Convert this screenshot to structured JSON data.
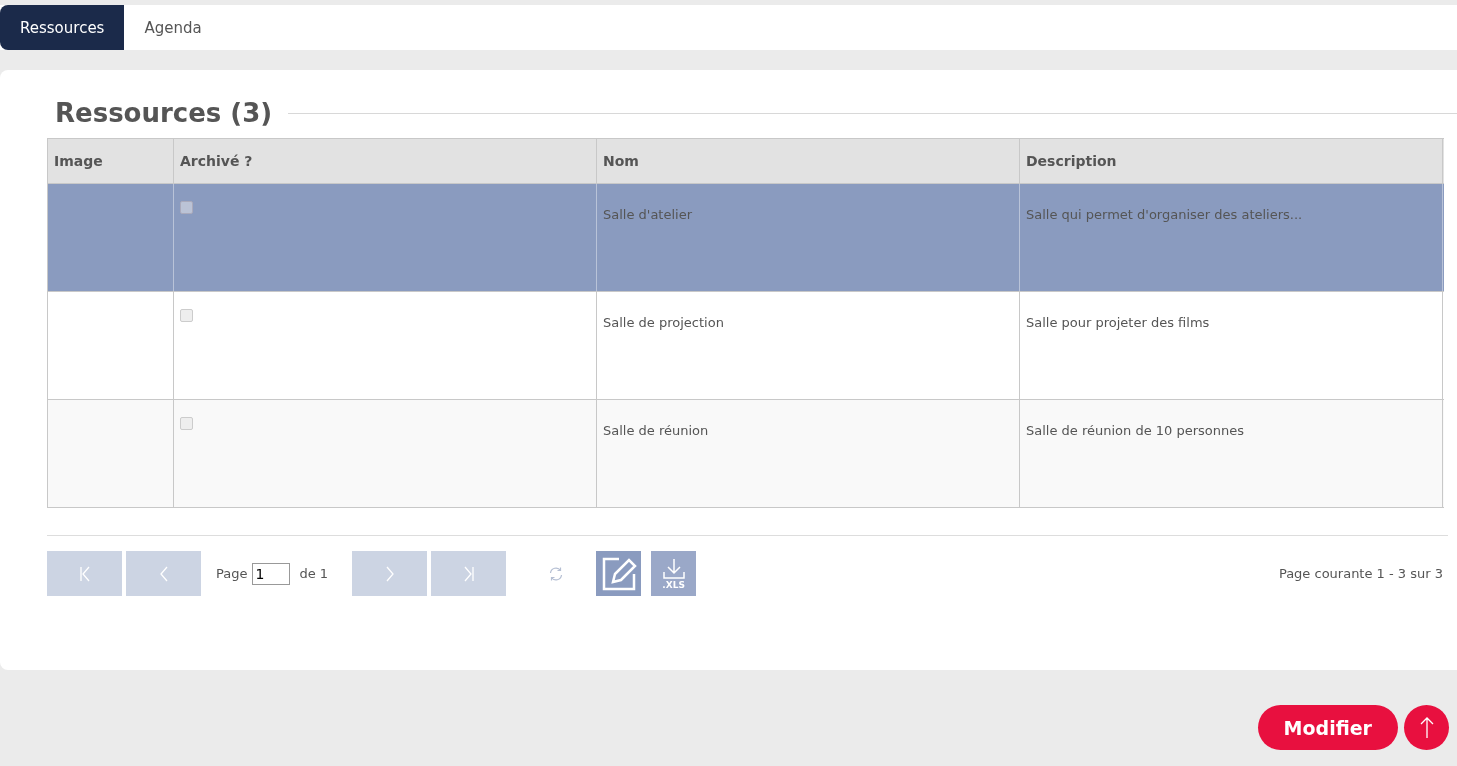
{
  "tabs": [
    {
      "label": "Ressources",
      "selected": true
    },
    {
      "label": "Agenda",
      "selected": false
    }
  ],
  "section": {
    "title": "Ressources (3)"
  },
  "table": {
    "columns": [
      "Image",
      "Archivé ?",
      "Nom",
      "Description"
    ],
    "rows": [
      {
        "selected": true,
        "archived": false,
        "name": "Salle d'atelier",
        "description": "Salle qui permet d'organiser des ateliers..."
      },
      {
        "selected": false,
        "archived": false,
        "name": "Salle de projection",
        "description": "Salle pour projeter des films"
      },
      {
        "selected": false,
        "archived": false,
        "name": "Salle de réunion",
        "description": "Salle de réunion de 10 personnes"
      }
    ]
  },
  "pager": {
    "nav": [
      {
        "kind": "first",
        "disabled": true
      },
      {
        "kind": "prev",
        "disabled": true
      },
      {
        "kind": "next",
        "disabled": true
      },
      {
        "kind": "last",
        "disabled": true
      }
    ],
    "page_label": "Page",
    "page_value": "1",
    "of_label": "de 1",
    "xls_label": ".XLS",
    "summary": "Page courante 1 - 3 sur 3"
  },
  "actions": {
    "primary": "Modifier"
  }
}
